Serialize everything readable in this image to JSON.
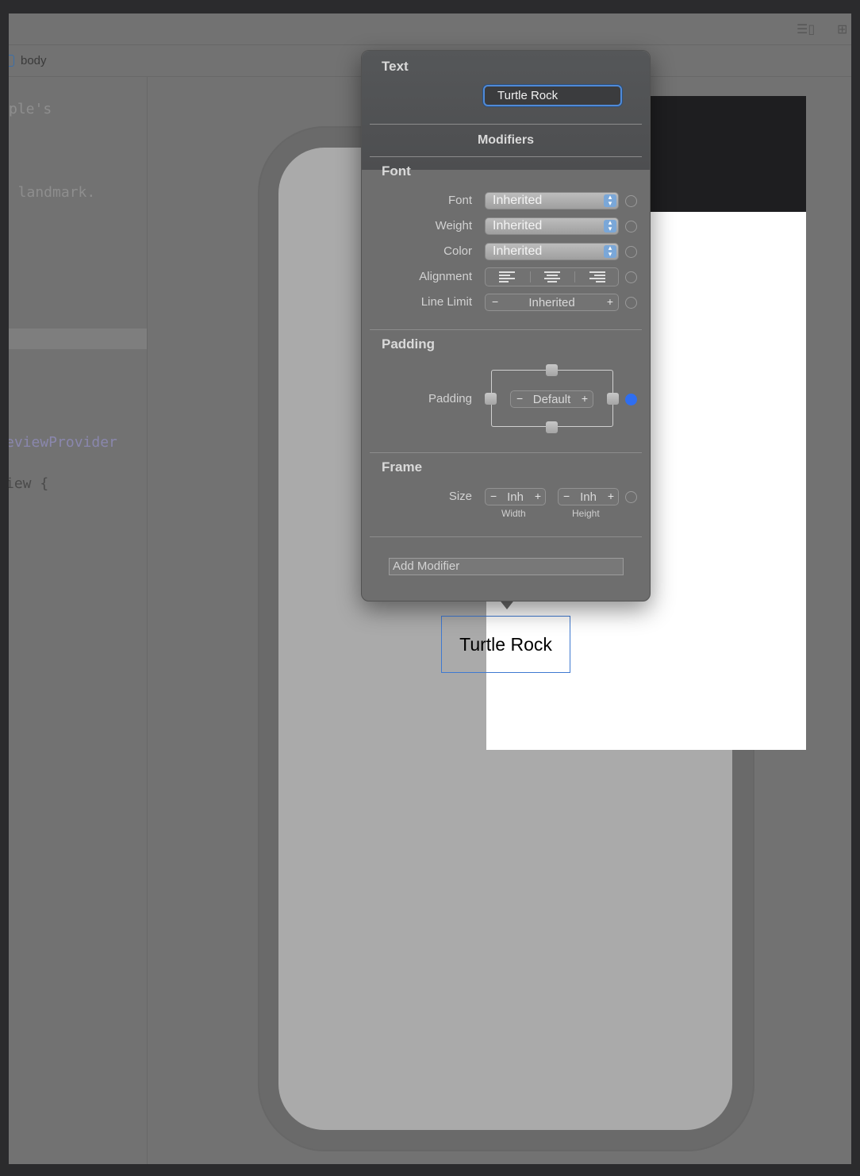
{
  "editor": {
    "breadcrumb": "body",
    "lines": [
      {
        "text": "ple's",
        "kind": "comment"
      },
      {
        "text": " a landmark.",
        "kind": "comment"
      },
      {
        "text": "eviewProvider",
        "kind": "type"
      },
      {
        "text": "iew {",
        "kind": "plain"
      }
    ]
  },
  "preview": {
    "text": "Turtle Rock"
  },
  "inspector": {
    "header": "Text",
    "text_value": "Turtle Rock",
    "modifiers_title": "Modifiers",
    "font_section": {
      "title": "Font",
      "font_label": "Font",
      "font_value": "Inherited",
      "weight_label": "Weight",
      "weight_value": "Inherited",
      "color_label": "Color",
      "color_value": "Inherited",
      "alignment_label": "Alignment",
      "alignment_options": [
        "left-align-icon",
        "center-align-icon",
        "right-align-icon"
      ],
      "line_limit_label": "Line Limit",
      "line_limit_value": "Inherited",
      "minus": "−",
      "plus": "+"
    },
    "padding_section": {
      "title": "Padding",
      "padding_label": "Padding",
      "padding_value": "Default",
      "active": true
    },
    "frame_section": {
      "title": "Frame",
      "size_label": "Size",
      "width_value": "Inh",
      "height_value": "Inh",
      "width_label": "Width",
      "height_label": "Height"
    },
    "add_modifier_placeholder": "Add Modifier"
  },
  "colors": {
    "accent": "#2f6ef0",
    "selection": "#3f79d1"
  }
}
